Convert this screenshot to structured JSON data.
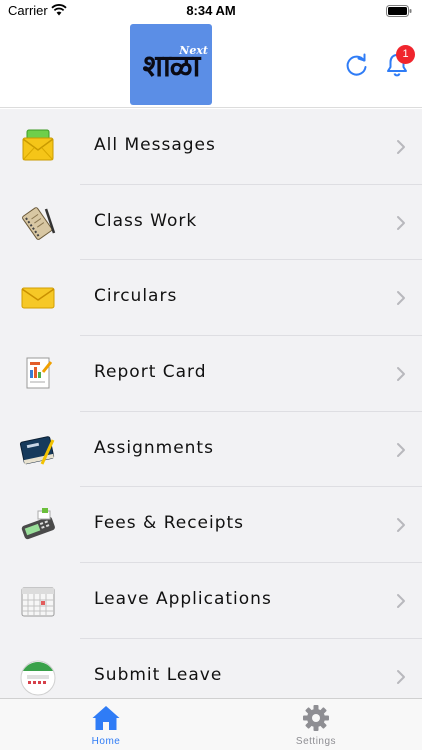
{
  "status_bar": {
    "carrier": "Carrier",
    "time": "8:34 AM"
  },
  "header": {
    "logo_text": "शाळा",
    "logo_superscript": "Next",
    "notification_count": "1",
    "accent_color": "#2f7cf6"
  },
  "menu": {
    "items": [
      {
        "label": "All Messages",
        "icon": "envelope-stack-icon"
      },
      {
        "label": "Class Work",
        "icon": "notebook-pencil-icon"
      },
      {
        "label": "Circulars",
        "icon": "envelope-icon"
      },
      {
        "label": "Report Card",
        "icon": "report-document-icon"
      },
      {
        "label": "Assignments",
        "icon": "book-pen-icon"
      },
      {
        "label": "Fees & Receipts",
        "icon": "card-machine-icon"
      },
      {
        "label": "Leave Applications",
        "icon": "calendar-icon"
      },
      {
        "label": "Submit Leave",
        "icon": "calendar-badge-icon"
      }
    ]
  },
  "tabbar": {
    "tabs": [
      {
        "label": "Home",
        "icon": "home-icon",
        "active": true
      },
      {
        "label": "Settings",
        "icon": "gear-icon",
        "active": false
      }
    ],
    "active_color": "#2f7cf6",
    "inactive_color": "#8e8e93"
  }
}
